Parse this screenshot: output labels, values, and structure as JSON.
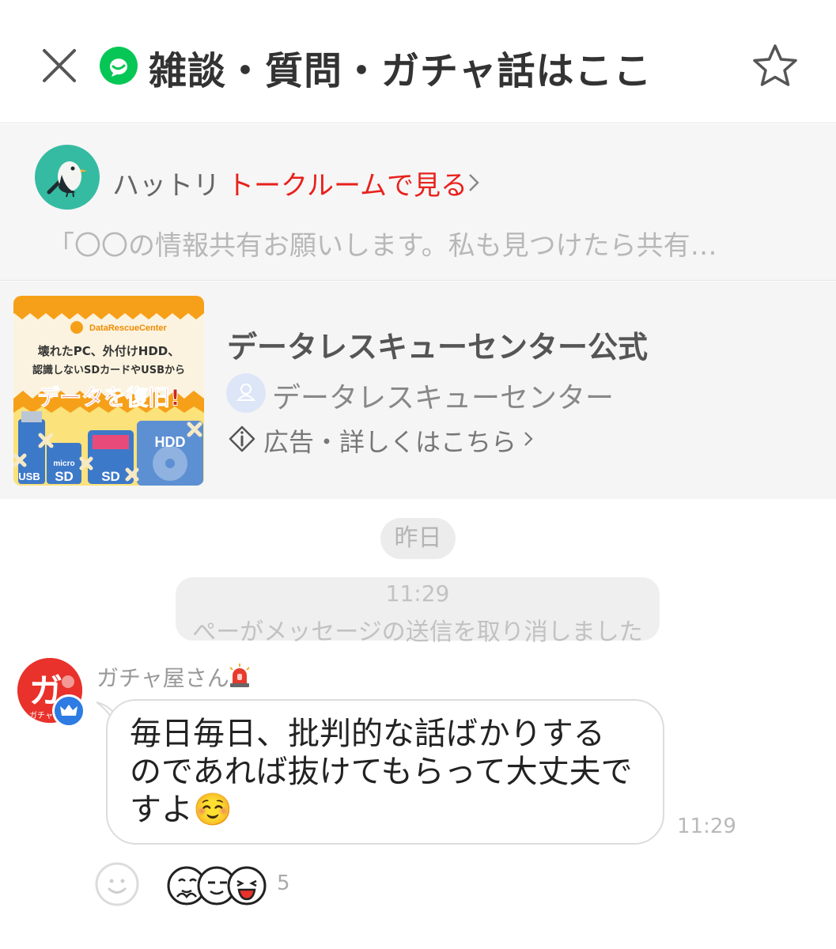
{
  "header": {
    "title": "雑談・質問・ガチャ話はここ",
    "close_icon": "close-icon",
    "room_icon": "openchat-icon",
    "favorite_icon": "star-icon"
  },
  "announcement": {
    "author": "ハットリ",
    "link": "トークルームで見る",
    "text": "「〇〇の情報共有お願いします。私も見つけたら共有…"
  },
  "ad": {
    "image_text": {
      "brand": "DataRescueCenter",
      "line1": "壊れたPC、外付けHDD、",
      "line2": "認識しないSDカードやUSBから",
      "headline": "データを復旧!",
      "labels": [
        "USB",
        "micro",
        "SD",
        "SD",
        "HDD"
      ]
    },
    "title": "データレスキューセンター公式",
    "advertiser": "データレスキューセンター",
    "label": "広告・詳しくはこちら"
  },
  "chat": {
    "date": "昨日",
    "system": {
      "time": "11:29",
      "text": "ぺーがメッセージの送信を取り消しました"
    },
    "messages": [
      {
        "sender": "ガチャ屋さん",
        "avatar_text": "ガ",
        "avatar_subtext": "ガチャ",
        "text": "毎日毎日、批判的な話ばかりするのであれば抜けてもらって大丈夫ですよ☺️",
        "time": "11:29",
        "reaction_count": "5"
      }
    ]
  },
  "colors": {
    "accent": "#e8211c",
    "openchat_green": "#06c755",
    "ad_red": "#c8281e",
    "badge_blue": "#2d7be3"
  }
}
